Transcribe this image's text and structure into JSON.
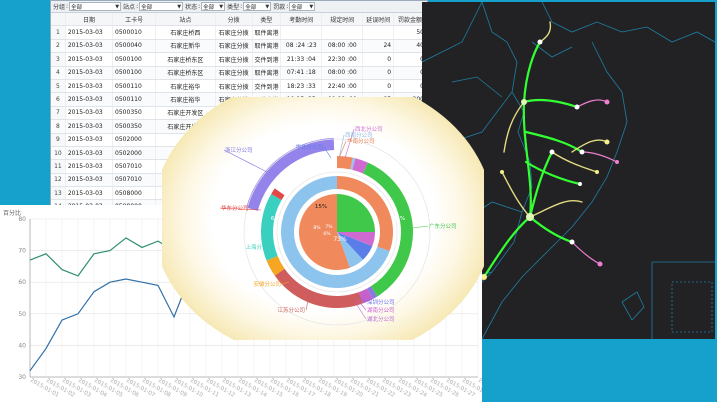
{
  "filters": [
    {
      "label": "分组",
      "value": "全部"
    },
    {
      "label": "站点",
      "value": "全部"
    },
    {
      "label": "状态",
      "value": "全部"
    },
    {
      "label": "类型",
      "value": "全部"
    },
    {
      "label": "罚款",
      "value": "全部"
    }
  ],
  "table": {
    "columns": [
      "",
      "日期",
      "工卡号",
      "站点",
      "分拨",
      "类型",
      "考勤时间",
      "规定时间",
      "延误时间",
      "罚款金额"
    ],
    "rows": [
      [
        "1",
        "2015-03-03",
        "0500010",
        "石家庄桥西",
        "石家庄分拨",
        "取件离港",
        "",
        "",
        "",
        "50"
      ],
      [
        "2",
        "2015-03-03",
        "0500040",
        "石家庄新华",
        "石家庄分拨",
        "取件离港",
        "08 :24 :23",
        "08:00 :00",
        "24",
        "40"
      ],
      [
        "3",
        "2015-03-03",
        "0500100",
        "石家庄桥东区",
        "石家庄分拨",
        "交件到港",
        "21:33 :04",
        "22:30 :00",
        "0",
        "0"
      ],
      [
        "4",
        "2015-03-03",
        "0500100",
        "石家庄桥东区",
        "石家庄分拨",
        "取件离港",
        "07:41 :18",
        "08:00 :00",
        "0",
        "0"
      ],
      [
        "5",
        "2015-03-03",
        "0500110",
        "石家庄裕华",
        "石家庄分拨",
        "交件到港",
        "18:23 :33",
        "22:40 :00",
        "0",
        "0"
      ],
      [
        "6",
        "2015-03-03",
        "0500110",
        "石家庄裕华",
        "石家庄分拨",
        "取件离港",
        "10:25 :35",
        "09:00 :00",
        "85",
        "200"
      ],
      [
        "7",
        "2015-03-03",
        "0500350",
        "石家庄开发区",
        "",
        "",
        "",
        "",
        "",
        ""
      ],
      [
        "8",
        "2015-03-03",
        "0500350",
        "石家庄开发区",
        "",
        "",
        "",
        "",
        "",
        ""
      ],
      [
        "9",
        "2015-03-03",
        "0502000",
        "石",
        "",
        "",
        "",
        "",
        "",
        ""
      ],
      [
        "10",
        "2015-03-03",
        "0502000",
        "",
        "",
        "",
        "",
        "",
        "",
        ""
      ],
      [
        "11",
        "2015-03-03",
        "0507010",
        "",
        "",
        "",
        "",
        "",
        "",
        ""
      ],
      [
        "12",
        "2015-03-03",
        "0507010",
        "",
        "",
        "",
        "",
        "",
        "",
        ""
      ],
      [
        "13",
        "2015-03-03",
        "0508000",
        "",
        "",
        "",
        "",
        "",
        "",
        ""
      ],
      [
        "14",
        "2015-03-03",
        "0508000",
        "",
        "",
        "",
        "",
        "",
        "",
        ""
      ]
    ]
  },
  "line_chart": {
    "y_title": "百分比",
    "chart_data": {
      "type": "line",
      "ylim": [
        30,
        80
      ],
      "y_ticks": [
        30,
        40,
        50,
        60,
        70,
        80
      ],
      "x": [
        "2015-01-01",
        "2015-01-02",
        "2015-01-03",
        "2015-01-04",
        "2015-01-05",
        "2015-01-06",
        "2015-01-07",
        "2015-01-08",
        "2015-01-09",
        "2015-01-10",
        "2015-01-11",
        "2015-01-12",
        "2015-01-13",
        "2015-01-14",
        "2015-01-15",
        "2015-01-16",
        "2015-01-17",
        "2015-01-18",
        "2015-01-19",
        "2015-01-20",
        "2015-01-21",
        "2015-01-22",
        "2015-01-23",
        "2015-01-24",
        "2015-01-25",
        "2015-01-26",
        "2015-01-27",
        "2015-01-28",
        "2015-01-29"
      ],
      "series": [
        {
          "color": "#2e8f6f",
          "values": [
            67,
            69,
            64,
            62,
            69,
            70,
            74,
            71,
            73,
            70,
            72
          ]
        },
        {
          "color": "#2f6fa8",
          "values": [
            32,
            39,
            48,
            50,
            57,
            60,
            61,
            60,
            59,
            49,
            62
          ]
        }
      ]
    }
  },
  "donut": {
    "center_labels": [
      "6%",
      "7%",
      "6%",
      "8%",
      "15%",
      "73%"
    ],
    "callouts": [
      {
        "text": "西北分公司",
        "color": "#cc6ccc"
      },
      {
        "text": "西南分公司",
        "color": "#8fb9e6"
      },
      {
        "text": "华南分公司",
        "color": "#e77b4d"
      },
      {
        "text": "华北分公司",
        "color": "#5b7de8"
      },
      {
        "text": "广东分公司",
        "color": "#3ec64a"
      },
      {
        "text": "深圳分公司",
        "color": "#6b6ee8"
      },
      {
        "text": "湖南分公司",
        "color": "#cc5fcf"
      },
      {
        "text": "湖北分公司",
        "color": "#b46ad3"
      },
      {
        "text": "江苏分公司",
        "color": "#cf5d5d"
      },
      {
        "text": "安徽分公司",
        "color": "#f5a623"
      },
      {
        "text": "上海分公司",
        "color": "#3ad0c0"
      },
      {
        "text": "华东分公司",
        "color": "#e24848"
      },
      {
        "text": "浙江分公司",
        "color": "#7b6fe0"
      }
    ],
    "inner_pct": {
      "a": "73%",
      "b": "45%",
      "c": "67%",
      "d": "15%"
    }
  },
  "colors": {
    "map_bg": "#222225",
    "route": "#33ff33",
    "route_yellow": "#f5f08a",
    "route_pink": "#ef7fd0"
  }
}
